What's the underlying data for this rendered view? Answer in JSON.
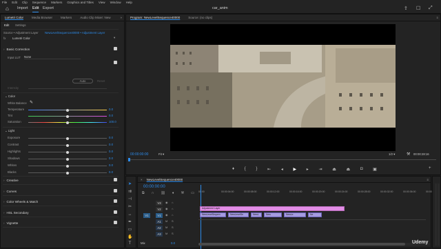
{
  "menu": [
    "File",
    "Edit",
    "Clip",
    "Sequence",
    "Markers",
    "Graphics and Titles",
    "View",
    "Window",
    "Help"
  ],
  "header": {
    "tabs": [
      "Import",
      "Edit",
      "Export"
    ],
    "active_tab": "Edit",
    "title": "car_anim"
  },
  "lumetri": {
    "tabs": [
      "Lumetri Color",
      "Media Browser",
      "Markers",
      "Audio Clip Mixer: New"
    ],
    "subtabs": [
      "Edit",
      "Settings"
    ],
    "source_label": "Source • Adjustment Layer",
    "sequence_label": "NewLevelSequence40000 • Adjustment Layer",
    "effect_label": "Lumetri Color",
    "basic_correction": "Basic Correction",
    "input_lut_label": "Input LUT",
    "input_lut_value": "None",
    "auto_label": "Auto",
    "reset_label": "Reset",
    "intensity_label": "Intensity",
    "color_heading": "Color",
    "white_balance_label": "White Balance",
    "color_sliders": [
      {
        "label": "Temperature",
        "value": "0.0",
        "pos": 0.5
      },
      {
        "label": "Tint",
        "value": "0.0",
        "pos": 0.5
      },
      {
        "label": "Saturation",
        "value": "100.0",
        "pos": 0.5
      }
    ],
    "light_heading": "Light",
    "light_sliders": [
      {
        "label": "Exposure",
        "value": "0.0",
        "pos": 0.5
      },
      {
        "label": "Contrast",
        "value": "0.0",
        "pos": 0.5
      },
      {
        "label": "Highlights",
        "value": "0.0",
        "pos": 0.5
      },
      {
        "label": "Shadows",
        "value": "0.0",
        "pos": 0.5
      },
      {
        "label": "Whites",
        "value": "0.0",
        "pos": 0.5
      },
      {
        "label": "Blacks",
        "value": "0.0",
        "pos": 0.5
      }
    ],
    "sections": [
      "Creative",
      "Curves",
      "Color Wheels & Match",
      "HSL Secondary",
      "Vignette"
    ]
  },
  "program": {
    "tabs": [
      "Program: NewLevelSequence40000",
      "Source: (no clips)"
    ],
    "timecode": "00:00:00:00",
    "fit": "Fit",
    "quality": "1/2",
    "duration": "00:00:28:16"
  },
  "timeline": {
    "tab": "NewLevelSequence40000",
    "timecode": "00:00:00:00",
    "ruler": [
      "00:00",
      "00:00:04:00",
      "00:00:08:00",
      "00:00:12:00",
      "00:00:16:00",
      "00:00:20:00",
      "00:00:24:00",
      "00:00:28:00",
      "00:00:32:00",
      "00:00:36:00",
      "00:00:40:00"
    ],
    "tracks": [
      "V3",
      "V2",
      "V1",
      "A1",
      "A2",
      "A3"
    ],
    "mix_label": "Mix",
    "mix_value": "0.0",
    "adjustment_clip": "Adjustment Layer",
    "v1_clips": [
      "NewLevelSequen",
      "NewLevelSe",
      "NewL",
      "New",
      "NewLe",
      "Ne"
    ]
  },
  "colors": {
    "accent": "#2d8ceb",
    "adjustment": "#e38de6",
    "clip": "#a59bdf"
  },
  "watermark": "Udemy"
}
